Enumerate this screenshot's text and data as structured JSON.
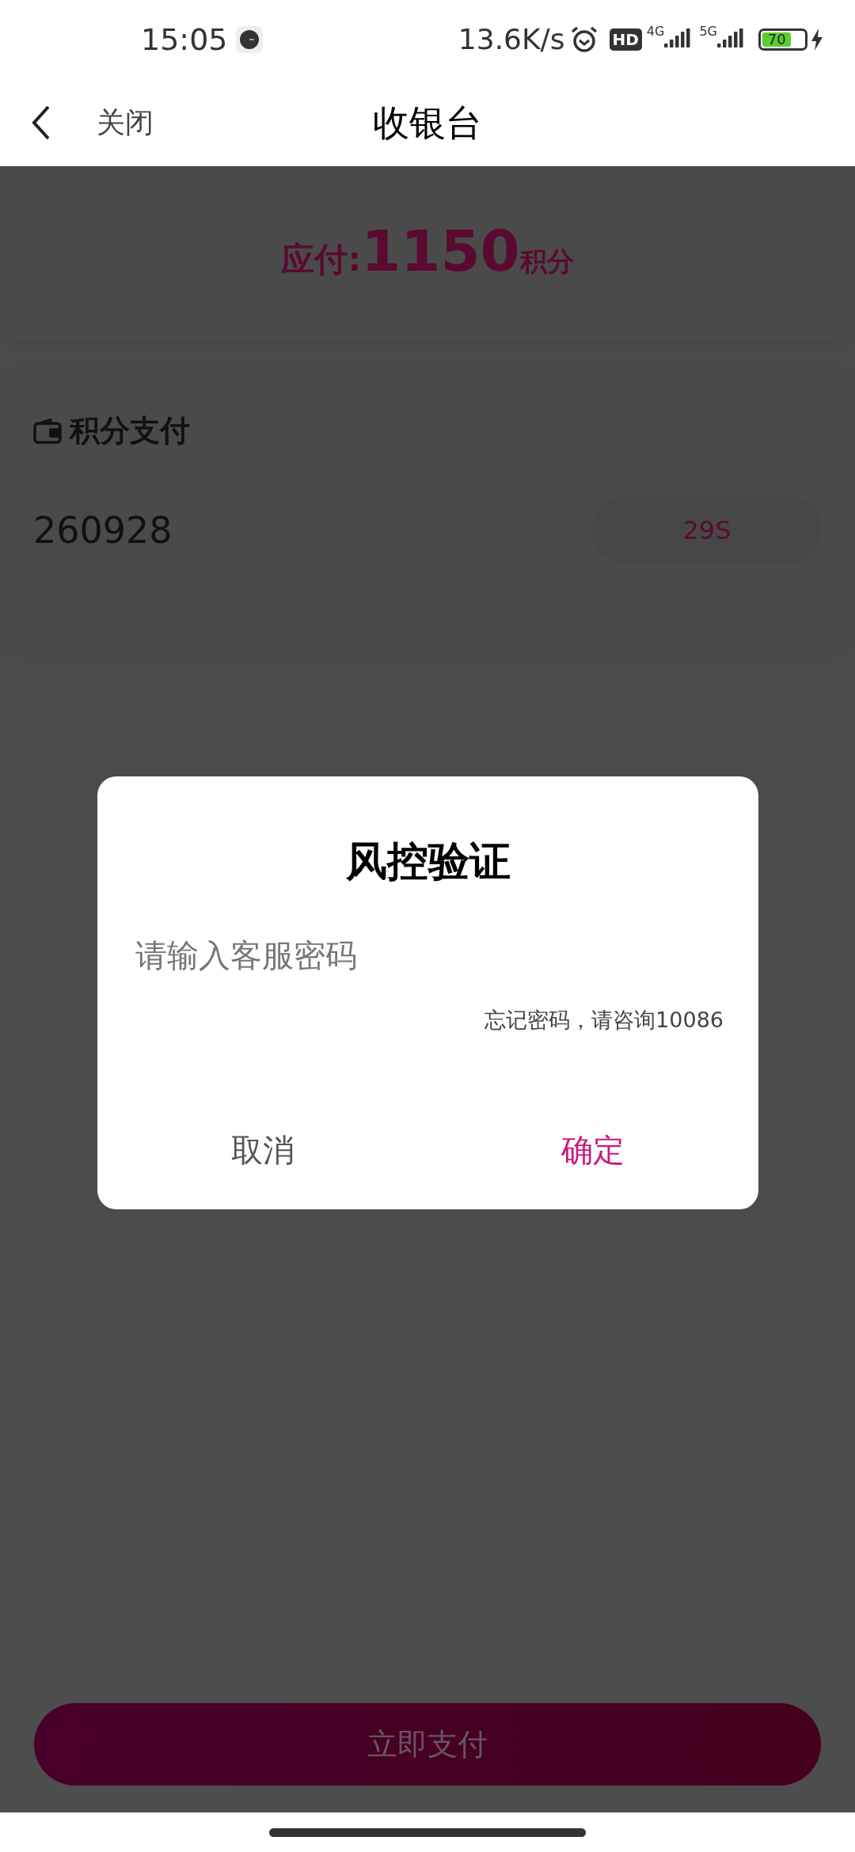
{
  "status_bar": {
    "time": "15:05",
    "net_speed": "13.6K/s",
    "hd": "HD",
    "network_1": "4G",
    "network_2": "5G",
    "battery": "70",
    "charging": true
  },
  "header": {
    "close_label": "关闭",
    "title": "收银台"
  },
  "amount": {
    "label": "应付:",
    "value": "1150",
    "unit": "积分"
  },
  "payment": {
    "title": "积分支付",
    "code": "260928",
    "countdown": "29S"
  },
  "dialog": {
    "title": "风控验证",
    "placeholder": "请输入客服密码",
    "hint": "忘记密码，请咨询10086",
    "cancel": "取消",
    "confirm": "确定"
  },
  "pay_button": "立即支付"
}
